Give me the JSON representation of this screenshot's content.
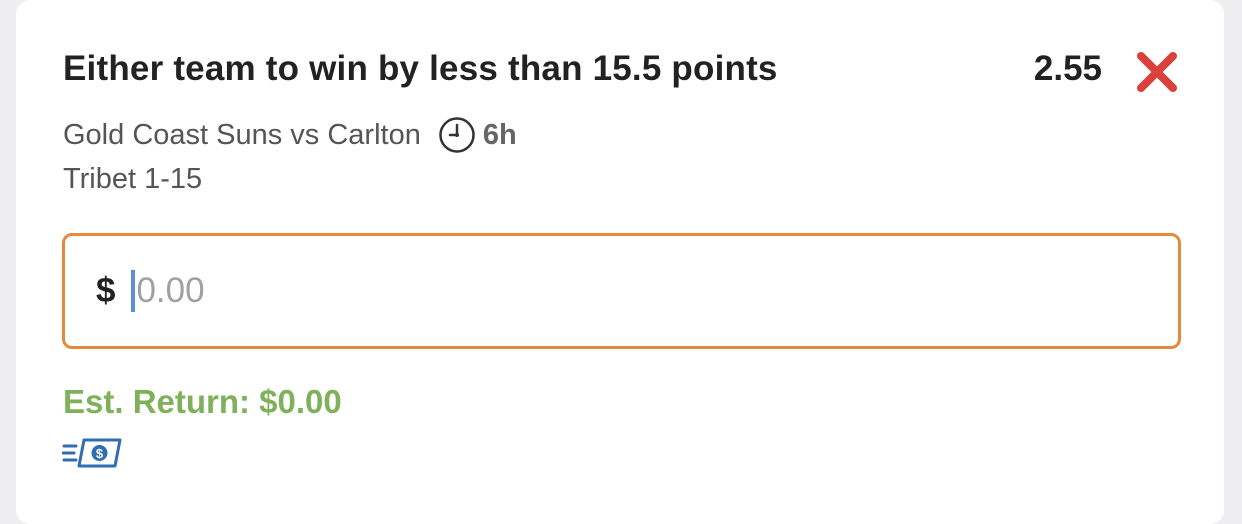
{
  "bet": {
    "selection": "Either team to win by less than 15.5 points",
    "odds": "2.55",
    "match": "Gold Coast Suns vs Carlton",
    "time_left": "6h",
    "market": "Tribet 1-15"
  },
  "stake": {
    "currency_symbol": "$",
    "placeholder": "0.00",
    "value": ""
  },
  "estimated_return": "Est. Return: $0.00",
  "icons": {
    "remove": "close-x-icon",
    "clock": "clock-icon",
    "cash": "fast-cash-icon"
  },
  "colors": {
    "remove": "#d9413a",
    "input_border": "#e58a3c",
    "caret": "#5a8fd6",
    "est_return": "#7fb05a",
    "cash_icon": "#2f6db5"
  }
}
